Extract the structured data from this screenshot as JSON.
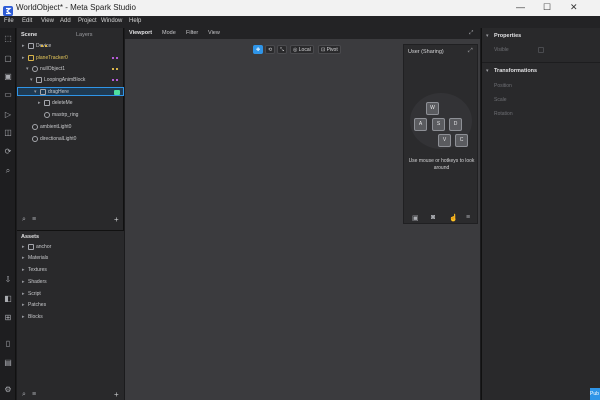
{
  "window": {
    "title": "WorldObject* - Meta Spark Studio",
    "minimize": "—",
    "maximize": "☐",
    "close": "✕"
  },
  "menu": [
    "File",
    "Edit",
    "View",
    "Add",
    "Project",
    "Window",
    "Help"
  ],
  "scene": {
    "tabs": [
      "Scene",
      "Layers"
    ],
    "items": [
      {
        "label": "Device"
      },
      {
        "label": "planeTracker0"
      },
      {
        "label": "nullObject1"
      },
      {
        "label": "LoopingAnimBlock"
      },
      {
        "label": "dragHere"
      },
      {
        "label": "deleteMe"
      },
      {
        "label": "mastrp_ring"
      },
      {
        "label": "ambientLight0"
      },
      {
        "label": "directionalLight0"
      }
    ]
  },
  "assets": {
    "title": "Assets",
    "items": [
      "anchor",
      "Materials",
      "Textures",
      "Shaders",
      "Script",
      "Patches",
      "Blocks"
    ]
  },
  "viewport": {
    "tabs": [
      "Viewport",
      "Mode",
      "Filter",
      "View"
    ],
    "local_label": "Local",
    "pivot_label": "Pivot"
  },
  "simulator": {
    "title": "User (Sharing)",
    "keys": [
      "W",
      "A",
      "S",
      "D",
      "V",
      "C"
    ],
    "hint": "Use mouse or hotkeys to look around"
  },
  "properties": {
    "title": "Properties",
    "visible_label": "Visible",
    "transformations_title": "Transformations",
    "fields": [
      "Position",
      "Scale",
      "Rotation"
    ]
  },
  "publish_label": "Pub",
  "colors": {
    "selection": "#2f95e8",
    "accent": "#2f95e8"
  }
}
